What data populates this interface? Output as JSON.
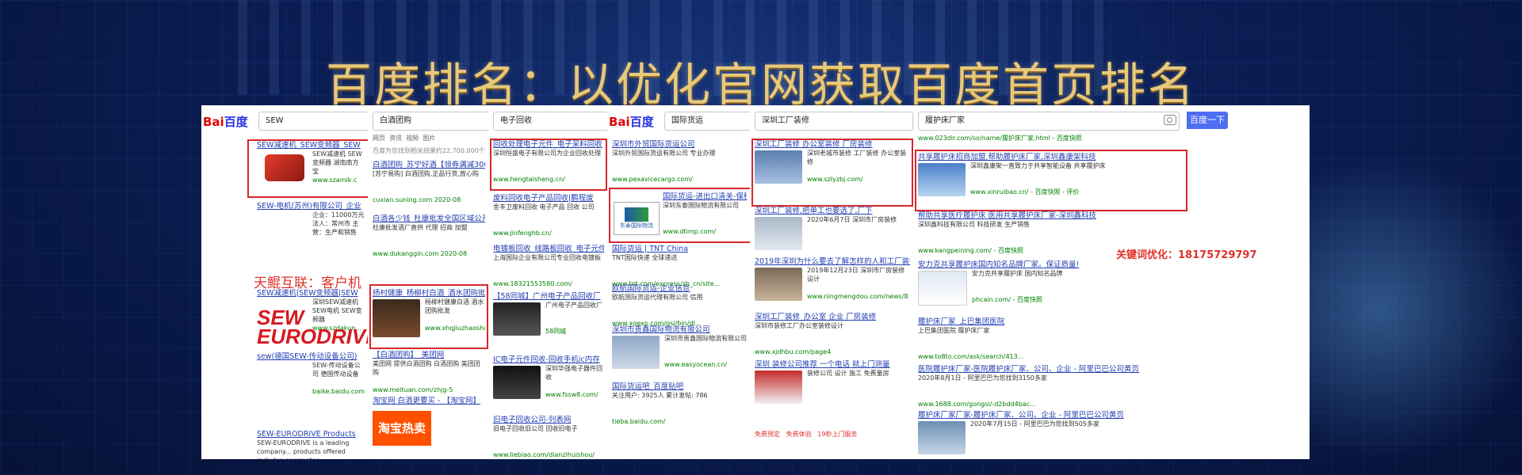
{
  "headline": "百度排名：以优化官网获取百度首页排名",
  "overlays": {
    "customer_case": "天鲲互联：客户机",
    "keyword_opt": "关键词优化：18175729797"
  },
  "panels": [
    {
      "query": "SEW",
      "results": [
        {
          "title": "SEW减速机_SEW变频器_SEW",
          "desc": "SEW减速机 SEW变频器 湖南南方宝",
          "url": "www.szamik.c"
        },
        {
          "title": "SEW-电机(苏州)有限公司_企业",
          "desc": "企业：11000万元 法人：常州市 主营：生产和销售",
          "url": "baike.baidu.com"
        },
        {
          "title": "SEW减速机|SEW变频器|SEW",
          "desc": "深圳SEW减速机 SEW电机 SEW变频器",
          "url": "www.szdakun..."
        },
        {
          "title": "sew(德国SEW-传动设备公司)",
          "desc": "SEW-传动设备公司 德国传动设备",
          "url": "baike.baidu.com"
        },
        {
          "title": "SEW-EURODRIVE Products",
          "desc": "SEW-EURODRIVE is a leading company... products offered includes gearmotor",
          "url": ""
        }
      ],
      "logo_text": "SEW EURODRIVE"
    },
    {
      "query": "白酒团购",
      "tabs": [
        "网页",
        "资讯",
        "视频",
        "图片"
      ],
      "count_note": "百度为您找到相关结果约22,700,000个",
      "results": [
        {
          "title": "白酒团购_苏宁好酒【领券满减300减",
          "desc": "[苏宁易购] 白酒团购,正品行货,放心购",
          "url": "cuxian.suning.com 2020-08"
        },
        {
          "title": "白酒各少钱_杜康批发全国区域公开征",
          "desc": "杜康批发酒厂直供 代理 招商 加盟",
          "url": "www.dukanggin.com 2020-08"
        },
        {
          "title": "扬村健康_杨柳村白酒_酒水团购批发",
          "desc": "杨柳村健康白酒 酒水团购批发",
          "url": "www.xhqjiuzhaosha"
        },
        {
          "title": "【白酒团购】_美团网",
          "desc": "美团网 提供白酒团购 白酒团购 美团团购",
          "url": "www.meituan.com/zhjg-5"
        },
        {
          "title": "淘宝网 白酒更要买 - 【淘宝网】",
          "desc": "淘宝网 白酒团购 品质保证",
          "url": ""
        }
      ],
      "taobao": "淘宝热卖"
    },
    {
      "query": "电子回收",
      "results": [
        {
          "title": "回收处理电子元件_电子呆料回收",
          "desc": "深圳恒盛电子有限公司为企业回收处理",
          "url": "www.hengtaisheng.cn/"
        },
        {
          "title": "废料回收电子产品回收|鹏程废",
          "desc": "金丰卫废料回收 电子产品 回收 公司",
          "url": "www.jinfenghb.cn/"
        },
        {
          "title": "电镀板回收_线路板回收_电子元件",
          "desc": "上海国际企业有限公司专业回收电镀板",
          "url": "www.18321553580.com/"
        },
        {
          "title": "【58同城】广州电子产品回收厂",
          "desc": "广州电子产品回收厂",
          "url": "58同城"
        },
        {
          "title": "IC电子元件回收-回收手机ic内存",
          "desc": "深圳华强电子器件回收",
          "url": "www.fssw8.com/"
        },
        {
          "title": "旧电子回收公司-列表网",
          "desc": "旧电子回收旧公司 回收旧电子",
          "url": "www.liebiao.com/dianzihuishou/"
        }
      ]
    },
    {
      "query": "国际货运",
      "results": [
        {
          "title": "深圳市外贸国际货运公司",
          "desc": "深圳外贸国际货运有限公司 专业办理",
          "url": "www.pexavicecargo.com/"
        },
        {
          "title": "国际货运-进出口清关-保税仓储-中港",
          "desc": "深圳东泰国际物流有限公司",
          "url": "www.dtimp.com/"
        },
        {
          "title": "国际货运 | TNT China",
          "desc": "TNT国际快递 全球递送",
          "url": "www.tnt.com/express/zh_cn/site..."
        },
        {
          "title": "欧航国际货运-企业信息",
          "desc": "欧航国际货运代理有限公司 信用",
          "url": "www.xqexp.com/gsi/bin/dl..."
        },
        {
          "title": "深圳市贵鑫国际物流有限公司",
          "desc": "深圳市贵鑫国际物流有限公司",
          "url": "www.easyocean.cn/"
        },
        {
          "title": "国际货运吧_百度贴吧",
          "desc": "关注用户: 3925人 累计发帖: 786",
          "url": "tieba.baidu.com/"
        }
      ],
      "logo_text": "东泰国际物流"
    },
    {
      "query": "深圳工厂装修",
      "results": [
        {
          "title": "深圳工厂装修 办公室装修 厂房装修",
          "desc": "深圳老城市装修 工厂装修 办公室装修",
          "url": "www.szlyzbj.com/"
        },
        {
          "title": "深圳工厂装修,把单工也要选了,厂下",
          "desc": "2020年6月7日 深圳市厂房装修",
          "url": ""
        },
        {
          "title": "2019年深圳为什么要去了解怎样的人和工厂装修",
          "desc": "2019年12月23日 深圳市厂房装修设计",
          "url": "www.ningmengdou.com/news/8"
        },
        {
          "title": "深圳工厂装修_办公室 企业 厂房装修",
          "desc": "深圳市装修工厂办公室装修设计",
          "url": "www.xjdhbu.com/page4"
        },
        {
          "title": "深圳 装修公司推荐 一个电话 就上门测量",
          "desc": "装修公司 设计 施工 免费量房",
          "url": ""
        }
      ],
      "promos": [
        "免费预定",
        "免费体验",
        "19秒上门服务"
      ]
    },
    {
      "query": "履护床厂家",
      "search_button": "百度一下",
      "top_url": "www.023dlr.com/so/name/履护床厂家.html - 百度快照",
      "results": [
        {
          "title": "共享履护床招商加盟,帮助履护床厂家,深圳鑫康架科技",
          "desc": "深圳鑫康架一直致力于共享智能设备 共享履护床",
          "url": "www.xinruibao.cn/ - 百度快照 - 评价"
        },
        {
          "title": "帮助共享医疗履护床 医用共享履护床厂家-深圳鑫科技",
          "desc": "深圳鑫科技有限公司 科技研发 生产销售",
          "url": "www.kangpeining.com/ - 百度快照"
        },
        {
          "title": "安力克共享履护床国内知名品牌厂家。保证质量!",
          "desc": "安力克共享履护床 国内知名品牌",
          "url": "phcain.com/ - 百度快照"
        },
        {
          "title": "履护床厂家_上巴集团医院",
          "desc": "上巴集团医院 履护床厂家",
          "url": "www.to8to.com/ask/search/413..."
        },
        {
          "title": "医院履护床厂家-医院履护床厂家、公司、企业 - 阿里巴巴公司黄页",
          "desc": "2020年8月1日 - 阿里巴巴为您找到3150多家",
          "url": "www.1688.com/gongsi/-d2bdd4bac..."
        },
        {
          "title": "履护床厂家厂家-履护床厂家、公司、企业 - 阿里巴巴公司黄页",
          "desc": "2020年7月15日 - 阿里巴巴为您找到505多家",
          "url": ""
        }
      ]
    }
  ],
  "colors": {
    "link": "#2440b3",
    "url": "#008000",
    "highlight": "#d9262c",
    "headline": "#e8c97a",
    "search_button": "#4e6ef2"
  }
}
